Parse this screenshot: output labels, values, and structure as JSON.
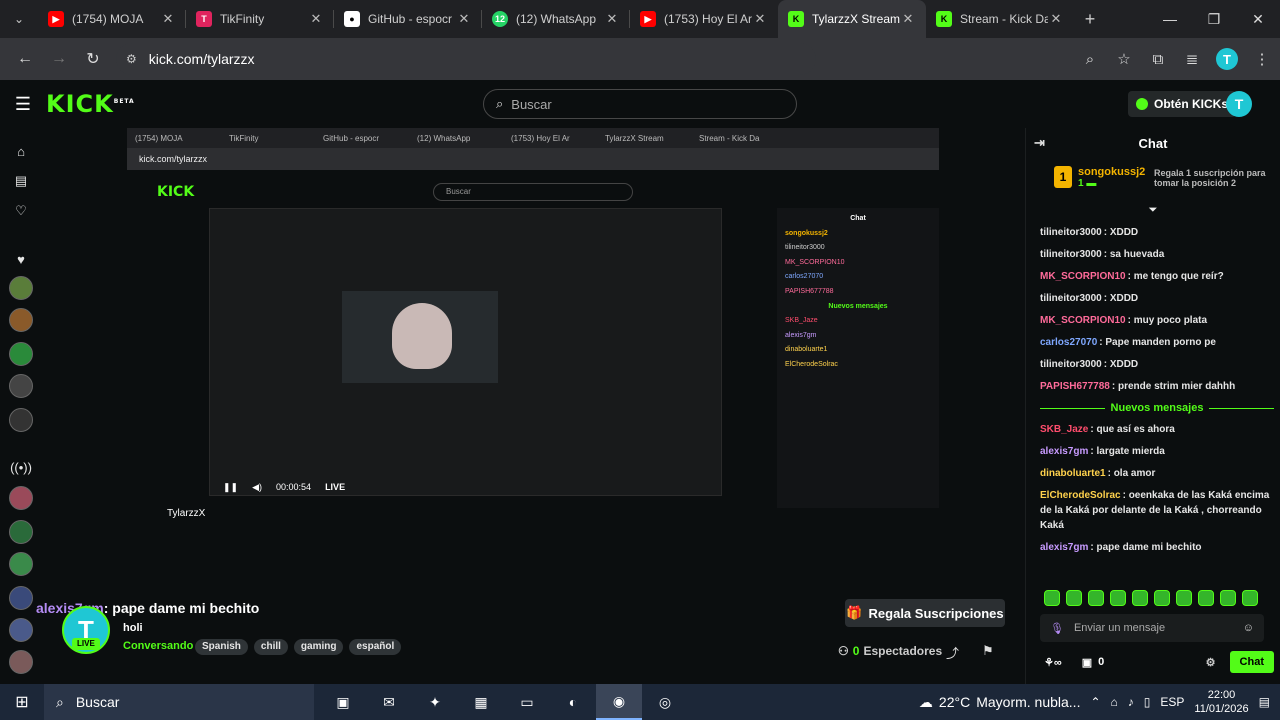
{
  "browser": {
    "tabs": [
      {
        "title": "(1754) MOJA",
        "icon": "youtube-icon",
        "color": "#ff0000",
        "active": false
      },
      {
        "title": "TikFinity",
        "icon": "tikfinity-icon",
        "color": "#e0245e",
        "active": false
      },
      {
        "title": "GitHub - espocr",
        "icon": "github-icon",
        "color": "#333333",
        "active": false
      },
      {
        "title": "(12) WhatsApp",
        "icon": "whatsapp-icon",
        "color": "#25d366",
        "active": false
      },
      {
        "title": "(1753) Hoy El Ar",
        "icon": "youtube-icon",
        "color": "#ff0000",
        "active": false
      },
      {
        "title": "TylarzzX Stream",
        "icon": "kick-icon",
        "color": "#53fc18",
        "active": true
      },
      {
        "title": "Stream - Kick Da",
        "icon": "kick-icon",
        "color": "#53fc18",
        "active": false
      }
    ],
    "url": "kick.com/tylarzzx",
    "profile_initial": "T"
  },
  "kick": {
    "logo": "KICK",
    "logo_beta": "BETA",
    "search_placeholder": "Buscar",
    "kicks_button": "Obtén KICKs",
    "user_initial": "T"
  },
  "nested": {
    "url": "kick.com/tylarzzx",
    "search": "Buscar",
    "time": "00:00:54",
    "live": "LIVE",
    "chat_title": "Chat",
    "new_msgs": "Nuevos mensajes"
  },
  "overlay": {
    "user": "alexis7gm",
    "text": ": pape dame mi bechito"
  },
  "stream": {
    "streamer": "TylarzzX",
    "title": "holi",
    "live_badge": "LIVE",
    "category": "Conversando",
    "tags": [
      "Spanish",
      "chill",
      "gaming",
      "español"
    ],
    "gift_button": "Regala Suscripciones",
    "viewers_count": "0",
    "viewers_label": "Espectadores"
  },
  "chat": {
    "title": "Chat",
    "pinned": {
      "user": "songokussj2",
      "count": "1",
      "description": "Regala 1 suscripción para tomar la posición 2"
    },
    "messages": [
      {
        "user": "tilineitor3000",
        "color": "#e6e6e6",
        "text": "XDDD"
      },
      {
        "user": "tilineitor3000",
        "color": "#e6e6e6",
        "text": "sa huevada"
      },
      {
        "user": "MK_SCORPION10",
        "color": "#ff6b9a",
        "text": "me tengo que reír?"
      },
      {
        "user": "tilineitor3000",
        "color": "#e6e6e6",
        "text": "XDDD"
      },
      {
        "user": "MK_SCORPION10",
        "color": "#ff6b9a",
        "text": "muy poco plata"
      },
      {
        "user": "carlos27070",
        "color": "#7fa8ff",
        "text": "Pape manden porno pe"
      },
      {
        "user": "tilineitor3000",
        "color": "#e6e6e6",
        "text": "XDDD"
      },
      {
        "user": "PAPISH677788",
        "color": "#ff6b9a",
        "text": "prende strim mier dahhh"
      }
    ],
    "new_messages_label": "Nuevos mensajes",
    "new_messages": [
      {
        "user": "SKB_Jaze",
        "color": "#ff4d6d",
        "text": "que así es ahora"
      },
      {
        "user": "alexis7gm",
        "color": "#c89bff",
        "text": "largate mierda"
      },
      {
        "user": "dinaboluarte1",
        "color": "#ffd24d",
        "text": "ola amor"
      },
      {
        "user": "ElCherodeSolrac",
        "color": "#ffd24d",
        "text": "oeenkaka de las Kaká encima de la Kaká por delante de la Kaká , chorreando Kaká"
      },
      {
        "user": "alexis7gm",
        "color": "#c89bff",
        "text": "pape dame mi bechito"
      }
    ],
    "input_placeholder": "Enviar un mensaje",
    "points": "0",
    "send_label": "Chat"
  },
  "taskbar": {
    "search": "Buscar",
    "temperature": "22°C",
    "weather": "Mayorm. nubla...",
    "lang": "ESP",
    "time": "22:00",
    "date": "11/01/2026"
  }
}
